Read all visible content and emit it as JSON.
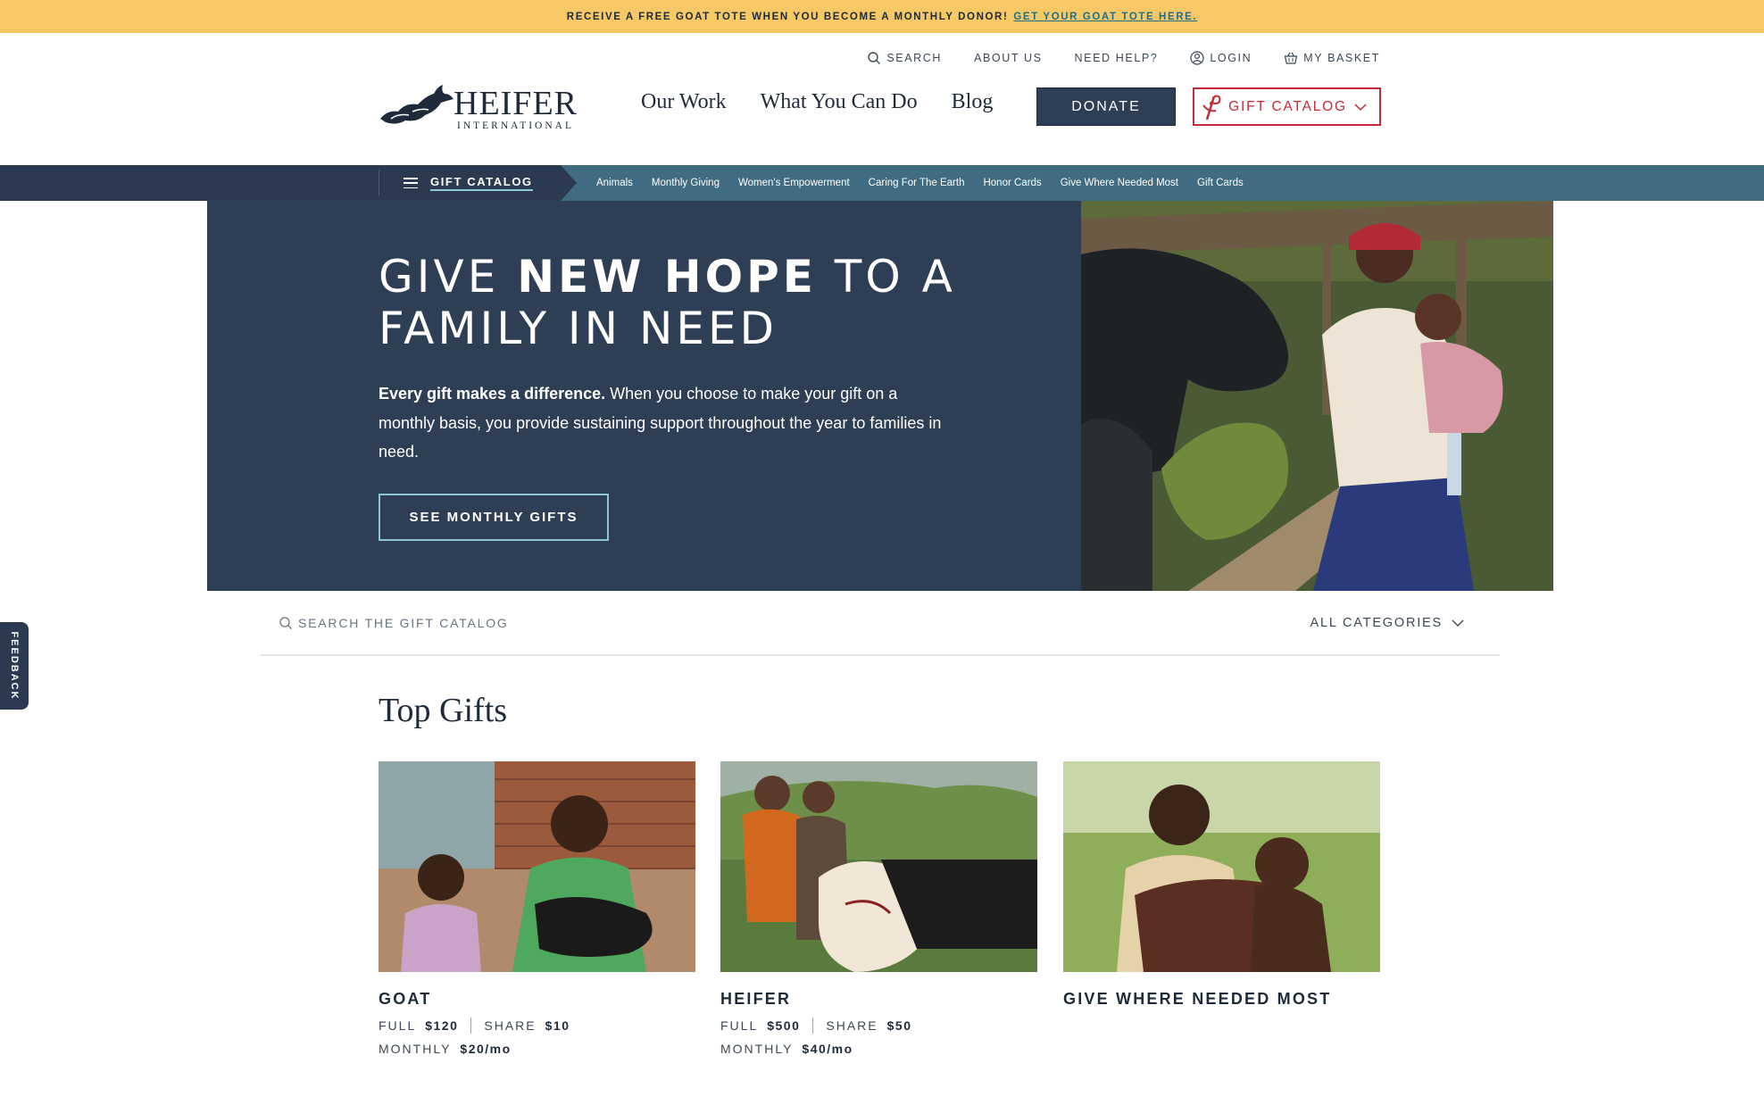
{
  "promo": {
    "text": "RECEIVE A FREE GOAT TOTE WHEN YOU BECOME A MONTHLY DONOR!",
    "link": "GET YOUR GOAT TOTE HERE."
  },
  "utility_nav": {
    "search": "SEARCH",
    "about": "ABOUT US",
    "help": "NEED HELP?",
    "login": "LOGIN",
    "basket": "MY BASKET"
  },
  "logo": {
    "name": "HEIFER",
    "sub": "INTERNATIONAL"
  },
  "main_nav": [
    "Our Work",
    "What You Can Do",
    "Blog"
  ],
  "buttons": {
    "donate": "DONATE",
    "gift_catalog": "GIFT CATALOG"
  },
  "subnav": {
    "menu_label": "GIFT CATALOG",
    "links": [
      "Animals",
      "Monthly Giving",
      "Women's Empowerment",
      "Caring For The Earth",
      "Honor Cards",
      "Give Where Needed Most",
      "Gift Cards"
    ]
  },
  "hero": {
    "title_part1": "GIVE ",
    "title_bold": "NEW HOPE",
    "title_part2": " TO A FAMILY IN NEED",
    "body_bold": "Every gift makes a difference.",
    "body": " When you choose to make your gift on a monthly basis, you provide sustaining support throughout the year to families in need.",
    "cta": "SEE MONTHLY GIFTS"
  },
  "catalog_search": {
    "placeholder": "SEARCH THE GIFT CATALOG",
    "category": "ALL CATEGORIES"
  },
  "feedback": "FEEDBACK",
  "top_gifts": {
    "title": "Top Gifts",
    "cards": [
      {
        "name": "GOAT",
        "full_label": "FULL",
        "full": "$120",
        "share_label": "SHARE",
        "share": "$10",
        "monthly_label": "MONTHLY",
        "monthly": "$20/mo"
      },
      {
        "name": "HEIFER",
        "full_label": "FULL",
        "full": "$500",
        "share_label": "SHARE",
        "share": "$50",
        "monthly_label": "MONTHLY",
        "monthly": "$40/mo"
      },
      {
        "name": "GIVE WHERE NEEDED MOST"
      }
    ]
  },
  "colors": {
    "promo_bg": "#f6c866",
    "navy": "#2e3e55",
    "teal": "#3f6c81",
    "red": "#c42b34",
    "accent_light": "#8ec5d6"
  }
}
